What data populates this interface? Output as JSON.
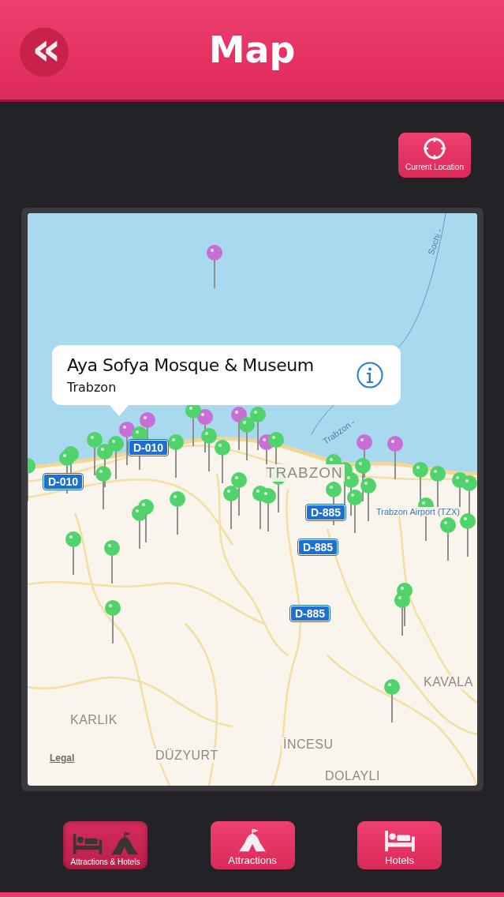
{
  "header": {
    "title": "Map",
    "back_icon": "«"
  },
  "current_location": {
    "label": "Current Location"
  },
  "map": {
    "callout": {
      "title": "Aya Sofya Mosque & Museum",
      "subtitle": "Trabzon"
    },
    "labels": [
      {
        "kind": "route",
        "text": "Sochi -"
      },
      {
        "kind": "route",
        "text": "Trabzon -"
      },
      {
        "kind": "road",
        "text": "D-010"
      },
      {
        "kind": "road",
        "text": "D-010"
      },
      {
        "kind": "city",
        "text": "TRABZON"
      },
      {
        "kind": "road",
        "text": "D-885"
      },
      {
        "kind": "road",
        "text": "D-885"
      },
      {
        "kind": "road",
        "text": "D-885"
      },
      {
        "kind": "airport",
        "text": "Trabzon Airport (TZX)"
      },
      {
        "kind": "town",
        "text": "KAVALA"
      },
      {
        "kind": "town",
        "text": "KARLIK"
      },
      {
        "kind": "town",
        "text": "DÜZYURT"
      },
      {
        "kind": "town",
        "text": "İNCESU"
      },
      {
        "kind": "town",
        "text": "DOLAYLI"
      }
    ],
    "legal": "Legal"
  },
  "tabs": [
    {
      "label": "Attractions & Hotels",
      "kind": "both",
      "selected": true
    },
    {
      "label": "Attractions",
      "kind": "attractions",
      "selected": false
    },
    {
      "label": "Hotels",
      "kind": "hotels",
      "selected": false
    }
  ]
}
